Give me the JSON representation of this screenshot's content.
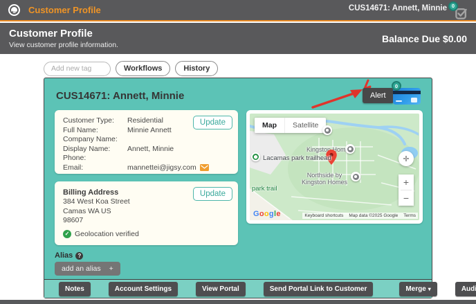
{
  "colors": {
    "accent_teal": "#5cc3b6",
    "accent_orange": "#ef9426",
    "dark_bar": "#59595b",
    "badge_teal": "#2fa896",
    "annotation_red": "#e0342b",
    "update_teal": "#4db6aa"
  },
  "topbar": {
    "back_arrow": "←",
    "title": "Customer Profile",
    "customer_ref": "CUS14671:  Annett, Minnie",
    "badge_count": "0"
  },
  "header": {
    "title": "Customer Profile",
    "subtitle": "View customer profile information.",
    "balance_due": "Balance Due $0.00"
  },
  "tags": {
    "add_tag_placeholder": "Add new tag",
    "workflows_label": "Workflows",
    "history_label": "History"
  },
  "card": {
    "title": "CUS14671: Annett, Minnie",
    "alert_label": "Alert",
    "payment_badge_count": "0",
    "info": {
      "rows": [
        {
          "label": "Customer Type:",
          "value": "Residential"
        },
        {
          "label": "Full Name:",
          "value": "Minnie Annett"
        },
        {
          "label": "Company Name:",
          "value": ""
        },
        {
          "label": "Display Name:",
          "value": "Annett, Minnie"
        },
        {
          "label": "Phone:",
          "value": ""
        },
        {
          "label": "Email:",
          "value": "mannettei@jigsy.com"
        }
      ],
      "update_label": "Update"
    },
    "billing": {
      "title": "Billing Address",
      "lines": [
        "384 West Koa Street",
        "Camas WA US",
        "98607"
      ],
      "verified_label": "Geolocation verified",
      "check_glyph": "✓",
      "update_label": "Update"
    },
    "map": {
      "map_tab": "Map",
      "satellite_tab": "Satellite",
      "poi_kingston": "Kingston Homes",
      "poi_lacamas": "Lacamas park trailhead",
      "poi_park_trail": "park trail",
      "poi_northside_line1": "Northside by",
      "poi_northside_line2": "Kingston Homes",
      "zoom_in": "+",
      "zoom_out": "−",
      "pan_glyph": "✛",
      "google": "Google",
      "attr_shortcuts": "Keyboard shortcuts",
      "attr_data": "Map data ©2025 Google",
      "attr_terms": "Terms"
    },
    "alias": {
      "label": "Alias",
      "help_glyph": "?",
      "add_button": "add an alias",
      "plus": "+"
    },
    "footer": {
      "notes": "Notes",
      "account_settings": "Account Settings",
      "view_portal": "View Portal",
      "send_portal_link": "Send Portal Link to Customer",
      "merge": "Merge",
      "merge_caret": "▾",
      "audit_log": "Audit Log"
    }
  }
}
